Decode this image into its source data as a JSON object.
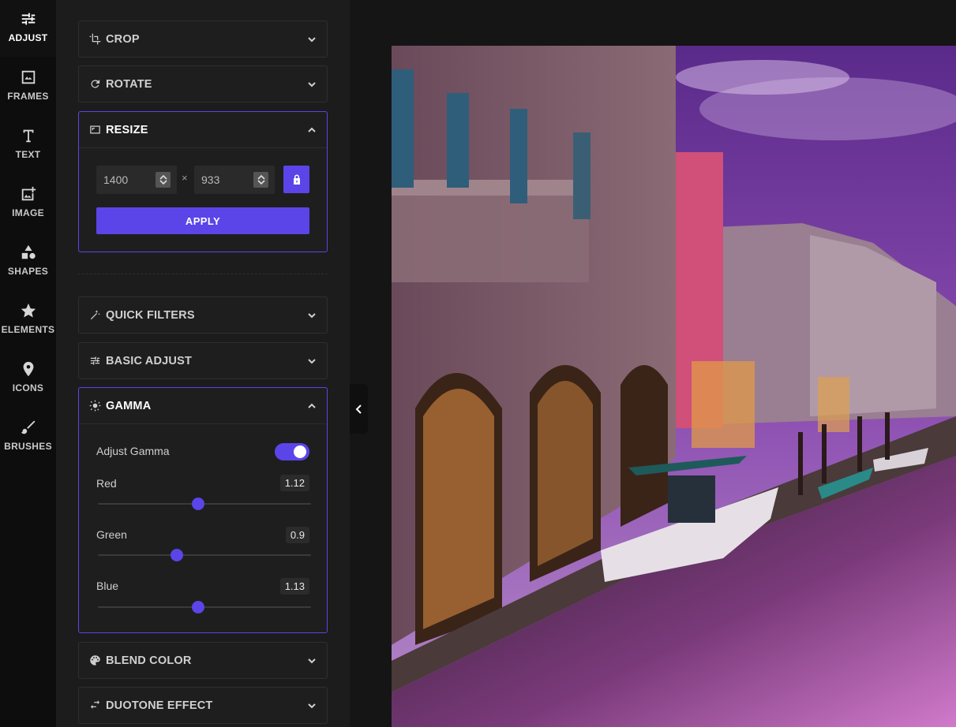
{
  "rail": [
    {
      "id": "adjust",
      "label": "ADJUST",
      "icon": "sliders-icon",
      "active": true
    },
    {
      "id": "frames",
      "label": "FRAMES",
      "icon": "frame-image-icon",
      "active": false
    },
    {
      "id": "text",
      "label": "TEXT",
      "icon": "text-t-icon",
      "active": false
    },
    {
      "id": "image",
      "label": "IMAGE",
      "icon": "add-image-icon",
      "active": false
    },
    {
      "id": "shapes",
      "label": "SHAPES",
      "icon": "shapes-icon",
      "active": false
    },
    {
      "id": "elements",
      "label": "ELEMENTS",
      "icon": "star-icon",
      "active": false
    },
    {
      "id": "icons",
      "label": "ICONS",
      "icon": "map-pin-icon",
      "active": false
    },
    {
      "id": "brushes",
      "label": "BRUSHES",
      "icon": "brush-icon",
      "active": false
    }
  ],
  "panels": {
    "crop": {
      "title": "CROP",
      "icon": "crop-icon"
    },
    "rotate": {
      "title": "ROTATE",
      "icon": "rotate-icon"
    },
    "resize": {
      "title": "RESIZE",
      "icon": "resize-icon",
      "width": "1400",
      "height": "933",
      "separator": "×",
      "apply_label": "APPLY"
    },
    "quick_filters": {
      "title": "QUICK FILTERS",
      "icon": "magic-wand-icon"
    },
    "basic_adjust": {
      "title": "BASIC ADJUST",
      "icon": "sliders-icon"
    },
    "gamma": {
      "title": "GAMMA",
      "icon": "sun-icon",
      "toggle_label": "Adjust Gamma",
      "toggle_on": true,
      "sliders": [
        {
          "label": "Red",
          "value": "1.12",
          "fraction": 0.47
        },
        {
          "label": "Green",
          "value": "0.9",
          "fraction": 0.37
        },
        {
          "label": "Blue",
          "value": "1.13",
          "fraction": 0.47
        }
      ]
    },
    "blend_color": {
      "title": "BLEND COLOR",
      "icon": "palette-icon"
    },
    "duotone": {
      "title": "DUOTONE EFFECT",
      "icon": "swap-arrows-icon"
    }
  },
  "colors": {
    "accent": "#5b45e8",
    "panel": "#1c1c1c",
    "rail": "#0d0d0d"
  }
}
